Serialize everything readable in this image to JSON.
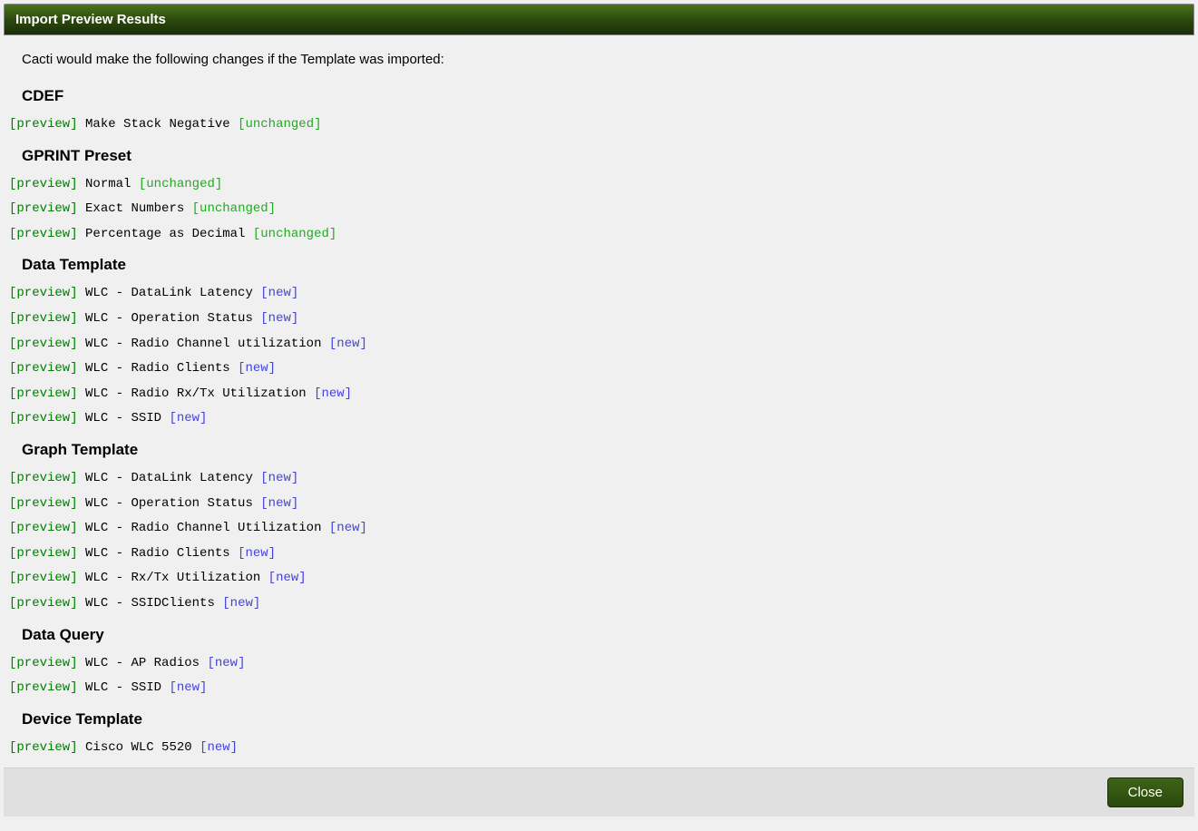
{
  "header": {
    "title": "Import Preview Results"
  },
  "intro": "Cacti would make the following changes if the Template was imported:",
  "previewLabel": "[preview]",
  "statusLabels": {
    "unchanged": "[unchanged]",
    "new": "[new]"
  },
  "sections": [
    {
      "heading": "CDEF",
      "items": [
        {
          "name": "Make Stack Negative",
          "status": "unchanged"
        }
      ]
    },
    {
      "heading": "GPRINT Preset",
      "items": [
        {
          "name": "Normal",
          "status": "unchanged"
        },
        {
          "name": "Exact Numbers",
          "status": "unchanged"
        },
        {
          "name": "Percentage as Decimal",
          "status": "unchanged"
        }
      ]
    },
    {
      "heading": "Data Template",
      "items": [
        {
          "name": "WLC - DataLink Latency",
          "status": "new"
        },
        {
          "name": "WLC - Operation Status",
          "status": "new"
        },
        {
          "name": "WLC - Radio Channel utilization",
          "status": "new"
        },
        {
          "name": "WLC - Radio Clients",
          "status": "new"
        },
        {
          "name": "WLC - Radio Rx/Tx Utilization",
          "status": "new"
        },
        {
          "name": "WLC - SSID",
          "status": "new"
        }
      ]
    },
    {
      "heading": "Graph Template",
      "items": [
        {
          "name": "WLC - DataLink Latency",
          "status": "new"
        },
        {
          "name": "WLC - Operation Status",
          "status": "new"
        },
        {
          "name": "WLC - Radio Channel Utilization",
          "status": "new"
        },
        {
          "name": "WLC - Radio Clients",
          "status": "new"
        },
        {
          "name": "WLC - Rx/Tx Utilization",
          "status": "new"
        },
        {
          "name": "WLC - SSIDClients",
          "status": "new"
        }
      ]
    },
    {
      "heading": "Data Query",
      "items": [
        {
          "name": "WLC - AP Radios",
          "status": "new"
        },
        {
          "name": "WLC - SSID",
          "status": "new"
        }
      ]
    },
    {
      "heading": "Device Template",
      "items": [
        {
          "name": "Cisco WLC 5520",
          "status": "new"
        }
      ]
    }
  ],
  "footer": {
    "closeLabel": "Close"
  }
}
